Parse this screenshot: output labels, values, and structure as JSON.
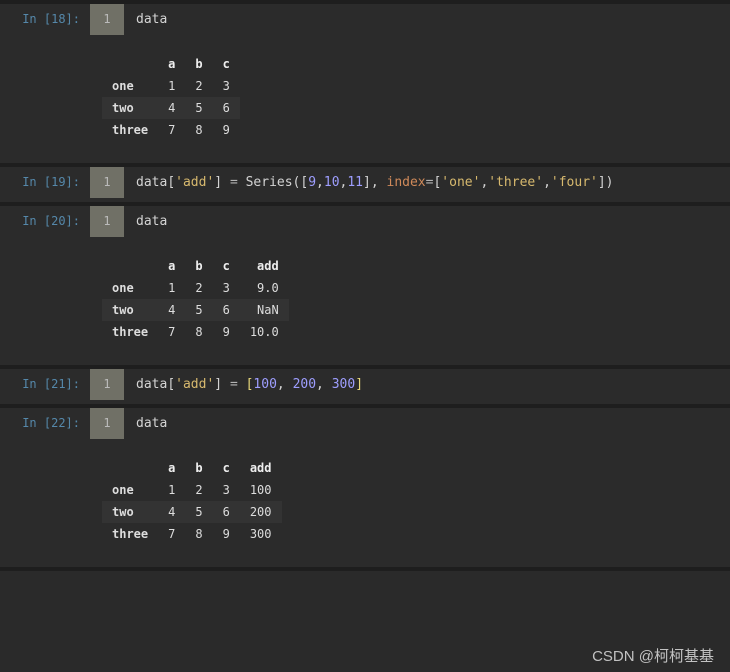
{
  "watermark": "CSDN @柯柯基基",
  "cells": [
    {
      "prompt": "In [18]:",
      "gutter": "1",
      "code": [
        {
          "cls": "n",
          "t": "data"
        }
      ],
      "table": {
        "columns": [
          "",
          "a",
          "b",
          "c"
        ],
        "rows": [
          [
            "one",
            "1",
            "2",
            "3"
          ],
          [
            "two",
            "4",
            "5",
            "6"
          ],
          [
            "three",
            "7",
            "8",
            "9"
          ]
        ]
      }
    },
    {
      "prompt": "In [19]:",
      "gutter": "1",
      "code": [
        {
          "cls": "n",
          "t": "data"
        },
        {
          "cls": "o",
          "t": "["
        },
        {
          "cls": "s",
          "t": "'add'"
        },
        {
          "cls": "o",
          "t": "] "
        },
        {
          "cls": "eq",
          "t": "= "
        },
        {
          "cls": "f",
          "t": "Series("
        },
        {
          "cls": "o",
          "t": "["
        },
        {
          "cls": "num",
          "t": "9"
        },
        {
          "cls": "o",
          "t": ","
        },
        {
          "cls": "num",
          "t": "10"
        },
        {
          "cls": "o",
          "t": ","
        },
        {
          "cls": "num",
          "t": "11"
        },
        {
          "cls": "o",
          "t": "], "
        },
        {
          "cls": "kw",
          "t": "index"
        },
        {
          "cls": "eq",
          "t": "="
        },
        {
          "cls": "o",
          "t": "["
        },
        {
          "cls": "s",
          "t": "'one'"
        },
        {
          "cls": "o",
          "t": ","
        },
        {
          "cls": "s",
          "t": "'three'"
        },
        {
          "cls": "o",
          "t": ","
        },
        {
          "cls": "s",
          "t": "'four'"
        },
        {
          "cls": "o",
          "t": "])"
        }
      ]
    },
    {
      "prompt": "In [20]:",
      "gutter": "1",
      "code": [
        {
          "cls": "n",
          "t": "data"
        }
      ],
      "table": {
        "columns": [
          "",
          "a",
          "b",
          "c",
          "add"
        ],
        "rows": [
          [
            "one",
            "1",
            "2",
            "3",
            "9.0"
          ],
          [
            "two",
            "4",
            "5",
            "6",
            "NaN"
          ],
          [
            "three",
            "7",
            "8",
            "9",
            "10.0"
          ]
        ]
      }
    },
    {
      "prompt": "In [21]:",
      "gutter": "1",
      "code": [
        {
          "cls": "n",
          "t": "data"
        },
        {
          "cls": "o",
          "t": "["
        },
        {
          "cls": "s",
          "t": "'add'"
        },
        {
          "cls": "o",
          "t": "] "
        },
        {
          "cls": "eq",
          "t": "= "
        },
        {
          "cls": "br",
          "t": "["
        },
        {
          "cls": "num",
          "t": "100"
        },
        {
          "cls": "o",
          "t": ", "
        },
        {
          "cls": "num",
          "t": "200"
        },
        {
          "cls": "o",
          "t": ", "
        },
        {
          "cls": "num",
          "t": "300"
        },
        {
          "cls": "br",
          "t": "]"
        }
      ]
    },
    {
      "prompt": "In [22]:",
      "gutter": "1",
      "code": [
        {
          "cls": "n",
          "t": "data"
        }
      ],
      "table": {
        "columns": [
          "",
          "a",
          "b",
          "c",
          "add"
        ],
        "rows": [
          [
            "one",
            "1",
            "2",
            "3",
            "100"
          ],
          [
            "two",
            "4",
            "5",
            "6",
            "200"
          ],
          [
            "three",
            "7",
            "8",
            "9",
            "300"
          ]
        ]
      }
    }
  ]
}
